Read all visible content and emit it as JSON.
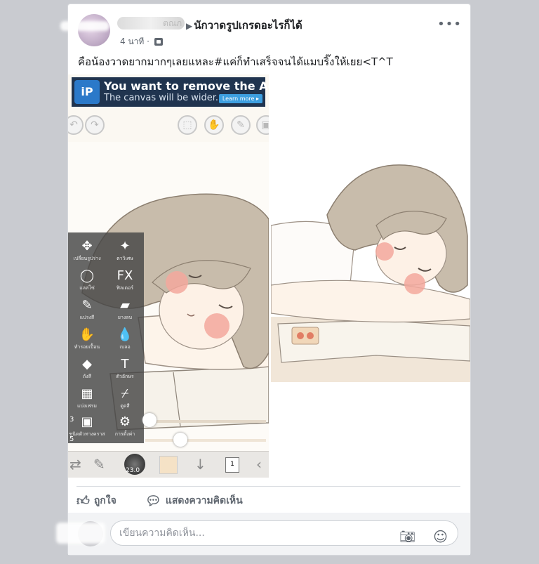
{
  "post": {
    "author_blurred": "ตณภ",
    "group_name": "นักวาดรูปเกรดอะไรก็ได้",
    "timestamp": "4 นาที",
    "separator": "·",
    "more_label": "•••",
    "text": "คือน้องวาดยากมากๆเลยแหละ#แค่ก็ทำเสร็จจนได้แมบริ๊งให้เยย<T^T"
  },
  "ad": {
    "logo": "iP",
    "title": "You want to remove the Ad?",
    "subtitle": "The canvas will be wider.",
    "button": "Learn more ▸"
  },
  "app_tools": [
    {
      "icon": "✥",
      "label": "เปลี่ยนรูปร่าง"
    },
    {
      "icon": "✦",
      "label": "ตาวิเศษ"
    },
    {
      "icon": "◯",
      "label": "แลสโซ่"
    },
    {
      "icon": "FX",
      "label": "ฟิลเตอร์"
    },
    {
      "icon": "✎",
      "label": "แปรงสี"
    },
    {
      "icon": "▰",
      "label": "ยางลบ"
    },
    {
      "icon": "✋",
      "label": "ทำรอยเปื้อน"
    },
    {
      "icon": "💧",
      "label": "เบลอ"
    },
    {
      "icon": "◆",
      "label": "ถังสี"
    },
    {
      "icon": "T",
      "label": "ตัวอักษร"
    },
    {
      "icon": "▦",
      "label": "แบ่งเฟรม"
    },
    {
      "icon": "⌿",
      "label": "ดูดสี"
    },
    {
      "icon": "▣",
      "label": "ชนิดตัวทางคราส"
    },
    {
      "icon": "⚙",
      "label": "การตั้งค่า"
    }
  ],
  "app_values": {
    "brush_size_value": "3",
    "brush_opacity_value": "5",
    "brush_preview_number": "23.0",
    "layer_number": "1"
  },
  "actions": {
    "like": "ถูกใจ",
    "comment": "แสดงความคิดเห็น"
  },
  "comment_box": {
    "placeholder": "เขียนความคิดเห็น..."
  },
  "colors": {
    "accent": "#4267b2",
    "text": "#1c1e21",
    "meta": "#606770",
    "hair": "#b9ad9c",
    "blush": "#f0a99b"
  }
}
